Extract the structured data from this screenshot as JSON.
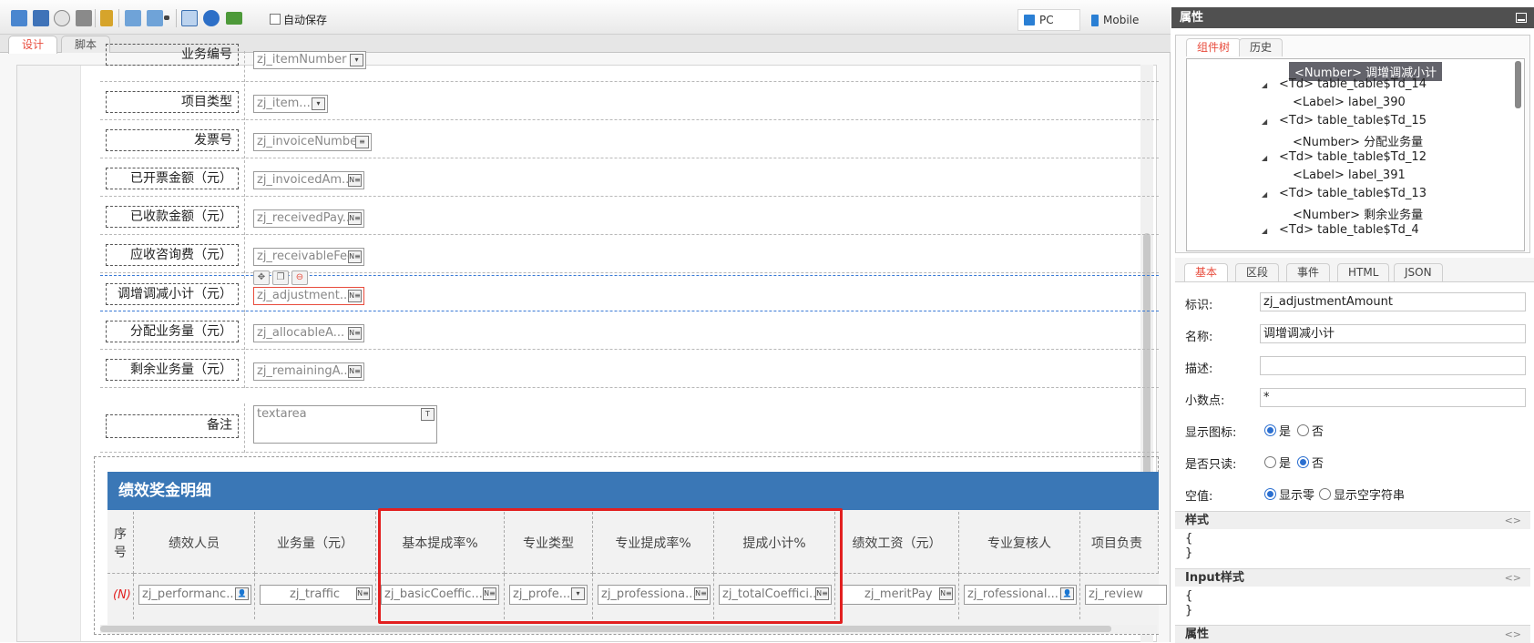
{
  "toolbar": {
    "autosave_label": "自动保存",
    "pc_label": "PC",
    "mobile_label": "Mobile"
  },
  "left_tabs": [
    "设计",
    "脚本"
  ],
  "form_rows": [
    {
      "label": "项目类型",
      "control": "zj_item...",
      "icon": "dropdown-icon"
    },
    {
      "label": "发票号",
      "control": "zj_invoiceNumber",
      "icon": "text-field-icon"
    },
    {
      "label": "已开票金额（元）",
      "control": "zj_invoicedAm...",
      "icon": "number-field-icon"
    },
    {
      "label": "已收款金额（元）",
      "control": "zj_receivedPay...",
      "icon": "number-field-icon"
    },
    {
      "label": "应收咨询费（元）",
      "control": "zj_receivableFee",
      "icon": "number-field-icon"
    },
    {
      "label": "调增调减小计（元）",
      "control": "zj_adjustment...",
      "icon": "number-field-icon"
    },
    {
      "label": "分配业务量（元）",
      "control": "zj_allocableA...",
      "icon": "number-field-icon"
    },
    {
      "label": "剩余业务量（元）",
      "control": "zj_remainingA...",
      "icon": "number-field-icon"
    }
  ],
  "partial_row": {
    "label": "业务编号",
    "control": "zj_itemNumber"
  },
  "remark": {
    "label": "备注",
    "placeholder": "textarea"
  },
  "detail_table": {
    "title": "绩效奖金明细",
    "seq_header": "序号",
    "row_marker": "(N)",
    "columns": [
      {
        "header": "绩效人员",
        "field": "zj_performanc..."
      },
      {
        "header": "业务量（元）",
        "field": "zj_traffic"
      },
      {
        "header": "基本提成率%",
        "field": "zj_basicCoeffic..."
      },
      {
        "header": "专业类型",
        "field": "zj_profe..."
      },
      {
        "header": "专业提成率%",
        "field": "zj_professiona..."
      },
      {
        "header": "提成小计%",
        "field": "zj_totalCoeffici..."
      },
      {
        "header": "绩效工资（元）",
        "field": "zj_meritPay"
      },
      {
        "header": "专业复核人",
        "field": "zj_rofessional..."
      },
      {
        "header": "项目负责",
        "field": "zj_review"
      }
    ]
  },
  "panel": {
    "title": "属性",
    "tree_tabs": [
      "组件树",
      "历史"
    ],
    "tree_nodes": [
      {
        "text": "<Number> 调增调减小计",
        "selected": true,
        "expander": false
      },
      {
        "text": "<Td> table_table$Td_14",
        "selected": false,
        "expander": true
      },
      {
        "text": "<Label> label_390",
        "selected": false,
        "expander": false
      },
      {
        "text": "<Td> table_table$Td_15",
        "selected": false,
        "expander": true
      },
      {
        "text": "<Number> 分配业务量",
        "selected": false,
        "expander": false
      },
      {
        "text": "<Td> table_table$Td_12",
        "selected": false,
        "expander": true
      },
      {
        "text": "<Label> label_391",
        "selected": false,
        "expander": false
      },
      {
        "text": "<Td> table_table$Td_13",
        "selected": false,
        "expander": true
      },
      {
        "text": "<Number> 剩余业务量",
        "selected": false,
        "expander": false
      },
      {
        "text": "<Td> table_table$Td_4",
        "selected": false,
        "expander": true
      }
    ],
    "prop_tabs": [
      "基本",
      "区段",
      "事件",
      "HTML",
      "JSON"
    ],
    "props": {
      "id_label": "标识:",
      "id_value": "zj_adjustmentAmount",
      "name_label": "名称:",
      "name_value": "调增调减小计",
      "desc_label": "描述:",
      "desc_value": "",
      "decimal_label": "小数点:",
      "decimal_value": "*",
      "showicon_label": "显示图标:",
      "showicon_yes": "是",
      "showicon_no": "否",
      "readonly_label": "是否只读:",
      "readonly_yes": "是",
      "readonly_no": "否",
      "empty_label": "空值:",
      "empty_zero": "显示零",
      "empty_blank": "显示空字符串"
    },
    "style_section": "样式",
    "input_style_section": "Input样式",
    "attr_section": "属性",
    "brace_open": "{",
    "brace_close": "}",
    "collapse_glyph": "<>"
  },
  "colors": {
    "accent_red": "#e84c3d",
    "table_header_blue": "#3a77b6",
    "highlight_red": "#e22020",
    "radio_blue": "#2b6fd0"
  }
}
